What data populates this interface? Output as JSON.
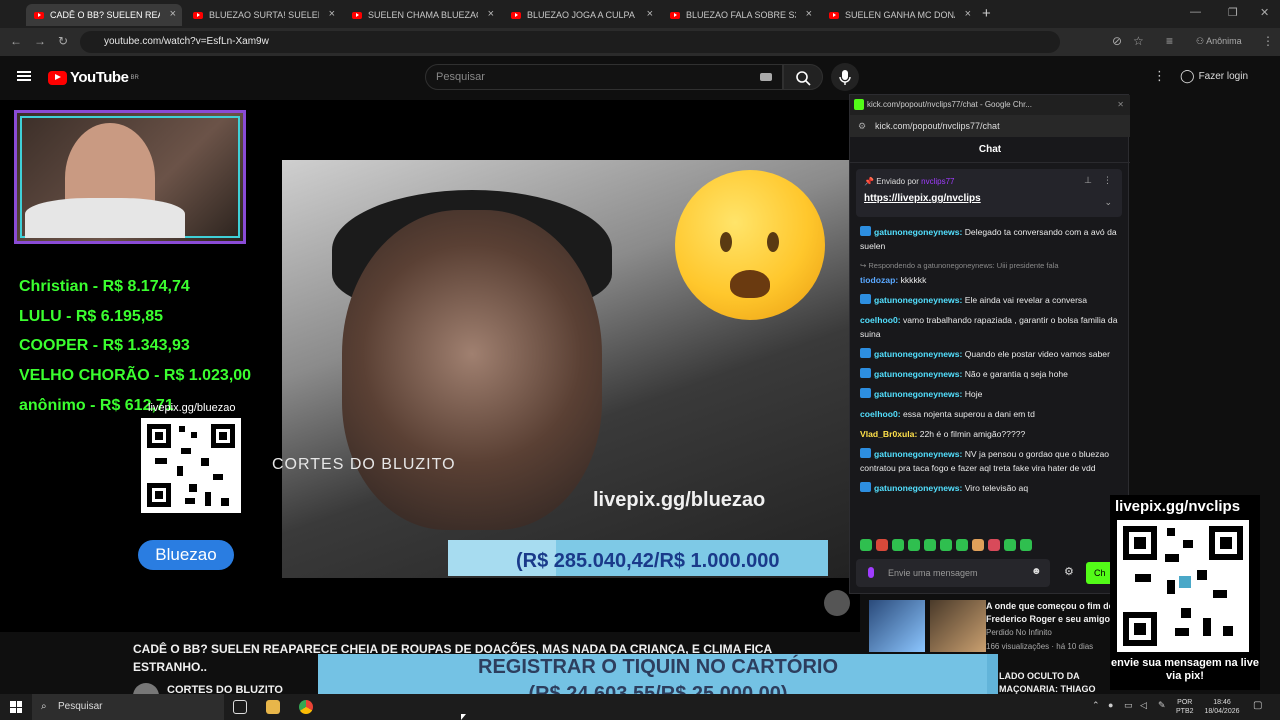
{
  "tabs": [
    {
      "title": "CADÊ O BB? SUELEN REAPA",
      "active": true
    },
    {
      "title": "BLUEZAO SURTA! SUELEN QUE"
    },
    {
      "title": "SUELEN CHAMA BLUEZAO DE"
    },
    {
      "title": "BLUEZAO JOGA A CULPA NO Y"
    },
    {
      "title": "BLUEZAO FALA SOBRE S3XUAL"
    },
    {
      "title": "SUELEN GANHA MC DONALD"
    }
  ],
  "address": {
    "url": "youtube.com/watch?v=EsfLn-Xam9w",
    "profile": "Anônima"
  },
  "youtube": {
    "logo": "YouTube",
    "region": "BR",
    "search_placeholder": "Pesquisar",
    "login": "Fazer login"
  },
  "overlay": {
    "donors": [
      "Christian - R$ 8.174,74",
      "LULU - R$ 6.195,85",
      "COOPER - R$ 1.343,93",
      "VELHO CHORÃO - R$ 1.023,00",
      "anônimo - R$ 612,71"
    ],
    "qr_label": "livepix.gg/bluezao",
    "cortes": "CORTES DO BLUZITO",
    "livepix_bluezao": "livepix.gg/bluezao",
    "badge": "Bluezao",
    "goal_text": "(R$ 285.040,42/R$ 1.000.000",
    "goal_fraction": 0.285,
    "nv_url": "livepix.gg/nvclips",
    "nv_text": "envie sua mensagem na live via pix!",
    "reg_line1": "REGISTRAR O TIQUIN NO CARTÓRIO",
    "reg_line2": "(R$ 24.603,55/R$ 25.000,00)",
    "reg_fraction": 0.984
  },
  "video": {
    "title": "CADÊ O BB? SUELEN REAPARECE CHEIA DE ROUPAS DE DOAÇÕES, MAS NADA DA CRIANÇA, E CLIMA FICA ESTRANHO..",
    "channel": "CORTES DO BLUZITO"
  },
  "kick": {
    "window_title": "kick.com/popout/nvclips77/chat - Google Chr...",
    "url": "kick.com/popout/nvclips77/chat",
    "header": "Chat",
    "pinned_by_label": "Enviado por",
    "pinned_by_user": "nvclips77",
    "pinned_link": "https://livepix.gg/nvclips",
    "input_placeholder": "Envie uma mensagem",
    "send_label": "Ch",
    "messages": [
      {
        "user": "gatunonegoneynews",
        "color": "#53e0ff",
        "text": "Delegado ta conversando com a avó da suelen",
        "badge": true
      },
      {
        "user": "tiodozap",
        "color": "#5aa8ff",
        "text": "kkkkkk",
        "reply": "Respondendo a gatunonegoneynews: Uiii presidente fala"
      },
      {
        "user": "gatunonegoneynews",
        "color": "#53e0ff",
        "text": "Ele ainda vai revelar a conversa",
        "badge": true
      },
      {
        "user": "coelhoo0",
        "color": "#53e0ff",
        "text": "vamo trabalhando rapaziada , garantir o bolsa familia da suina"
      },
      {
        "user": "gatunonegoneynews",
        "color": "#53e0ff",
        "text": "Quando ele postar video vamos saber",
        "badge": true
      },
      {
        "user": "gatunonegoneynews",
        "color": "#53e0ff",
        "text": "Não e garantia q seja hohe",
        "badge": true
      },
      {
        "user": "gatunonegoneynews",
        "color": "#53e0ff",
        "text": "Hoje",
        "badge": true
      },
      {
        "user": "coelhoo0",
        "color": "#53e0ff",
        "text": "essa nojenta superou a dani em td"
      },
      {
        "user": "Vlad_Br0xula",
        "color": "#ffe14a",
        "text": "22h é o filmin amigão?????"
      },
      {
        "user": "gatunonegoneynews",
        "color": "#53e0ff",
        "text": "NV ja pensou o gordao que o bluezao contratou pra taca fogo e fazer aql treta fake vira hater de vdd",
        "badge": true
      },
      {
        "user": "gatunonegoneynews",
        "color": "#53e0ff",
        "text": "Viro televisão aq",
        "badge": true
      }
    ]
  },
  "related": {
    "title": "A onde que começou o fim de Frederico Roger e seu amigo",
    "channel": "Perdido No Infinito",
    "meta": "166 visualizações · há 10 dias",
    "title2": "LADO OCULTO DA MAÇONARIA: THIAGO LIMA -"
  },
  "taskbar": {
    "search": "Pesquisar",
    "lang1": "POR",
    "lang2": "PTB2",
    "time": "18:46",
    "date": "18/04/2026"
  }
}
